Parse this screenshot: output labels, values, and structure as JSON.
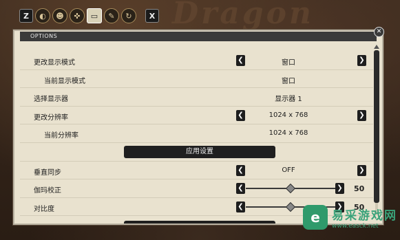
{
  "topbar": {
    "left_key": "Z",
    "right_key": "X",
    "tabs": [
      {
        "icon": "gamepad-icon",
        "glyph": "◐"
      },
      {
        "icon": "character-icon",
        "glyph": "☻"
      },
      {
        "icon": "controller-icon",
        "glyph": "✜"
      },
      {
        "icon": "display-icon",
        "glyph": "▭"
      },
      {
        "icon": "wrench-icon",
        "glyph": "✎"
      },
      {
        "icon": "refresh-icon",
        "glyph": "↻"
      }
    ]
  },
  "panel": {
    "title": "OPTIONS",
    "close_glyph": "✕"
  },
  "rows": {
    "display_mode": {
      "label": "更改显示模式",
      "value": "窗口"
    },
    "current_display_mode": {
      "label": "当前显示模式",
      "value": "窗口"
    },
    "select_monitor": {
      "label": "选择显示器",
      "value": "显示器 1"
    },
    "resolution": {
      "label": "更改分辨率",
      "value": "1024 x 768"
    },
    "current_resolution": {
      "label": "当前分辨率",
      "value": "1024 x 768"
    },
    "apply_label": "应用设置",
    "vsync": {
      "label": "垂直同步",
      "value": "OFF"
    },
    "gamma": {
      "label": "伽玛校正",
      "value": "50",
      "level": 0.5
    },
    "contrast": {
      "label": "对比度",
      "value": "50",
      "level": 0.5
    }
  },
  "arrows": {
    "left": "❮",
    "right": "❯"
  },
  "watermark": {
    "title": "易采游戏网",
    "url": "www.easck.net",
    "logo": "e"
  }
}
